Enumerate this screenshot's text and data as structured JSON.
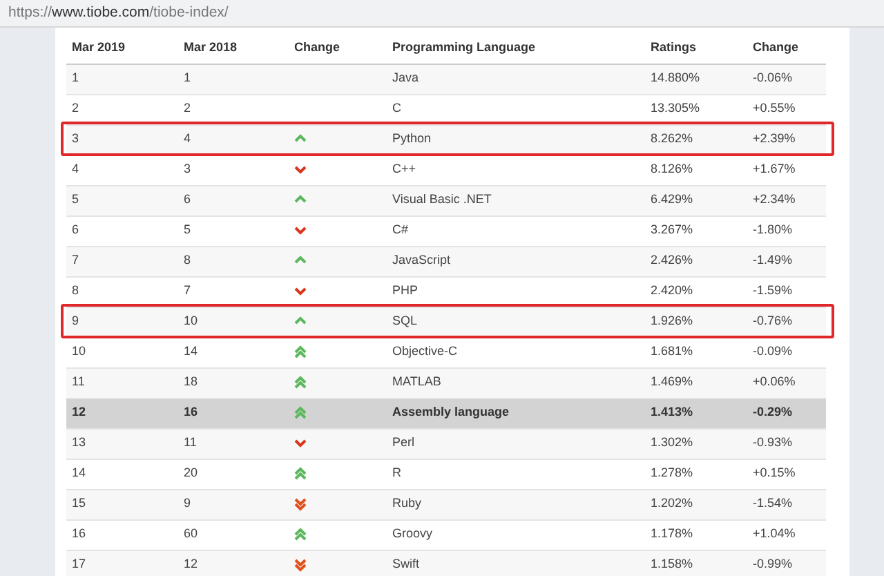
{
  "address_bar": {
    "url": "https://www.tiobe.com/tiobe-index/"
  },
  "table": {
    "columns": [
      "Mar 2019",
      "Mar 2018",
      "Change",
      "Programming Language",
      "Ratings",
      "Change"
    ],
    "rows": [
      {
        "cells": [
          "1",
          "1",
          "",
          "Java",
          "14.880%",
          "-0.06%"
        ],
        "kind": "none",
        "highlighted": false,
        "outlined": false
      },
      {
        "cells": [
          "2",
          "2",
          "",
          "C",
          "13.305%",
          "+0.55%"
        ],
        "kind": "none",
        "highlighted": false,
        "outlined": false
      },
      {
        "cells": [
          "3",
          "4",
          "",
          "Python",
          "8.262%",
          "+2.39%"
        ],
        "kind": "up",
        "highlighted": false,
        "outlined": true
      },
      {
        "cells": [
          "4",
          "3",
          "",
          "C++",
          "8.126%",
          "+1.67%"
        ],
        "kind": "down",
        "highlighted": false,
        "outlined": false
      },
      {
        "cells": [
          "5",
          "6",
          "",
          "Visual Basic .NET",
          "6.429%",
          "+2.34%"
        ],
        "kind": "up",
        "highlighted": false,
        "outlined": false
      },
      {
        "cells": [
          "6",
          "5",
          "",
          "C#",
          "3.267%",
          "-1.80%"
        ],
        "kind": "down",
        "highlighted": false,
        "outlined": false
      },
      {
        "cells": [
          "7",
          "8",
          "",
          "JavaScript",
          "2.426%",
          "-1.49%"
        ],
        "kind": "up",
        "highlighted": false,
        "outlined": false
      },
      {
        "cells": [
          "8",
          "7",
          "",
          "PHP",
          "2.420%",
          "-1.59%"
        ],
        "kind": "down",
        "highlighted": false,
        "outlined": false
      },
      {
        "cells": [
          "9",
          "10",
          "",
          "SQL",
          "1.926%",
          "-0.76%"
        ],
        "kind": "up",
        "highlighted": false,
        "outlined": true
      },
      {
        "cells": [
          "10",
          "14",
          "",
          "Objective-C",
          "1.681%",
          "-0.09%"
        ],
        "kind": "doubleup",
        "highlighted": false,
        "outlined": false
      },
      {
        "cells": [
          "11",
          "18",
          "",
          "MATLAB",
          "1.469%",
          "+0.06%"
        ],
        "kind": "doubleup",
        "highlighted": false,
        "outlined": false
      },
      {
        "cells": [
          "12",
          "16",
          "",
          "Assembly language",
          "1.413%",
          "-0.29%"
        ],
        "kind": "doubleup",
        "highlighted": true,
        "outlined": false
      },
      {
        "cells": [
          "13",
          "11",
          "",
          "Perl",
          "1.302%",
          "-0.93%"
        ],
        "kind": "down",
        "highlighted": false,
        "outlined": false
      },
      {
        "cells": [
          "14",
          "20",
          "",
          "R",
          "1.278%",
          "+0.15%"
        ],
        "kind": "doubleup",
        "highlighted": false,
        "outlined": false
      },
      {
        "cells": [
          "15",
          "9",
          "",
          "Ruby",
          "1.202%",
          "-1.54%"
        ],
        "kind": "doubledown",
        "highlighted": false,
        "outlined": false
      },
      {
        "cells": [
          "16",
          "60",
          "",
          "Groovy",
          "1.178%",
          "+1.04%"
        ],
        "kind": "doubleup",
        "highlighted": false,
        "outlined": false
      },
      {
        "cells": [
          "17",
          "12",
          "",
          "Swift",
          "1.158%",
          "-0.99%"
        ],
        "kind": "doubledown",
        "highlighted": false,
        "outlined": false
      }
    ]
  }
}
